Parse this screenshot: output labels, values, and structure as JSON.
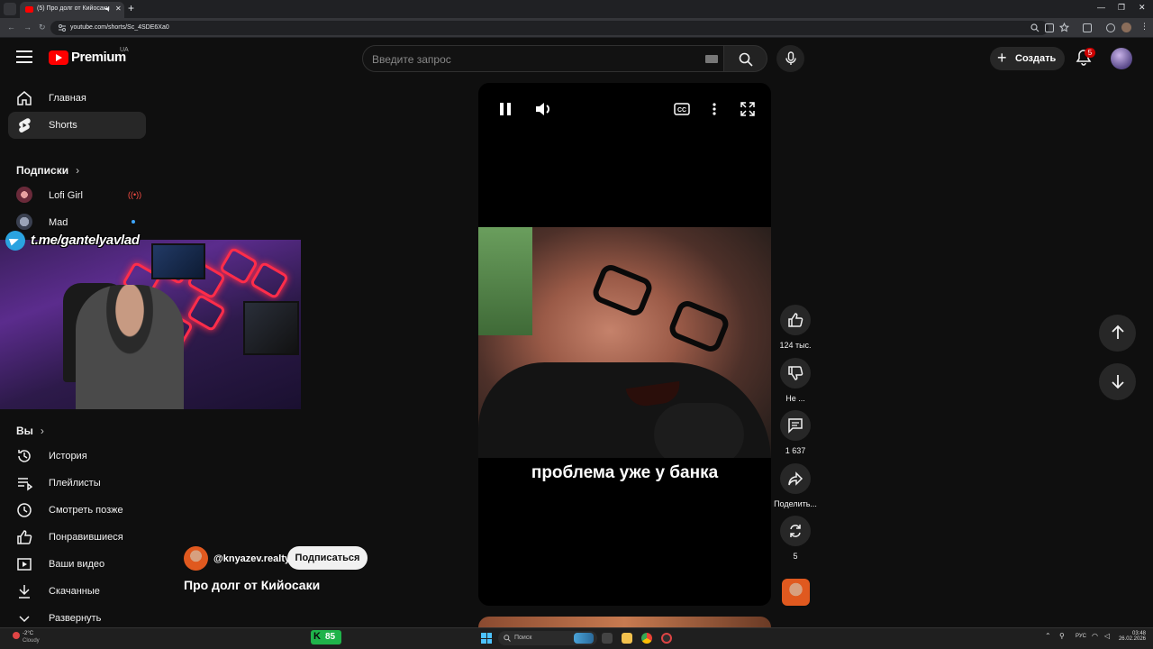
{
  "browser": {
    "tab_title": "(5) Про долг от Кийосаки",
    "url": "youtube.com/shorts/Sc_4SDE6Xa0"
  },
  "masthead": {
    "brand": "Premium",
    "region": "UA",
    "search_placeholder": "Введите запрос",
    "create_label": "Создать",
    "notifications_count": "5"
  },
  "sidebar": {
    "main": [
      {
        "label": "Главная",
        "icon": "home-icon"
      },
      {
        "label": "Shorts",
        "icon": "shorts-icon"
      }
    ],
    "subscriptions_header": "Подписки",
    "subscriptions": [
      {
        "label": "Lofi Girl"
      },
      {
        "label": "Mad"
      }
    ],
    "you_header": "Вы",
    "you": [
      {
        "label": "История",
        "icon": "history-icon"
      },
      {
        "label": "Плейлисты",
        "icon": "playlists-icon"
      },
      {
        "label": "Смотреть позже",
        "icon": "watch-later-icon"
      },
      {
        "label": "Понравившиеся",
        "icon": "liked-icon"
      },
      {
        "label": "Ваши видео",
        "icon": "your-videos-icon"
      },
      {
        "label": "Скачанные",
        "icon": "downloads-icon"
      },
      {
        "label": "Развернуть",
        "icon": "expand-icon"
      }
    ]
  },
  "overlay": {
    "telegram_text": "t.me/gantelyavlad"
  },
  "short": {
    "caption": "проблема уже у банка",
    "channel": "@knyazev.realty",
    "subscribe_label": "Подписаться",
    "title": "Про долг от Кийосаки"
  },
  "actions": {
    "likes": "124 тыс.",
    "dislike": "Не ...",
    "comments": "1 637",
    "share": "Поделить...",
    "remix": "5"
  },
  "taskbar": {
    "weather_temp": "-2°C",
    "weather_cond": "Cloudy",
    "kick_viewers": "85",
    "search_label": "Поиск",
    "lang": "РУС",
    "time": "03:48",
    "date": "26.02.2026"
  },
  "colors": {
    "accent": "#ff0000",
    "background": "#0f0f0f",
    "surface": "#272727"
  }
}
